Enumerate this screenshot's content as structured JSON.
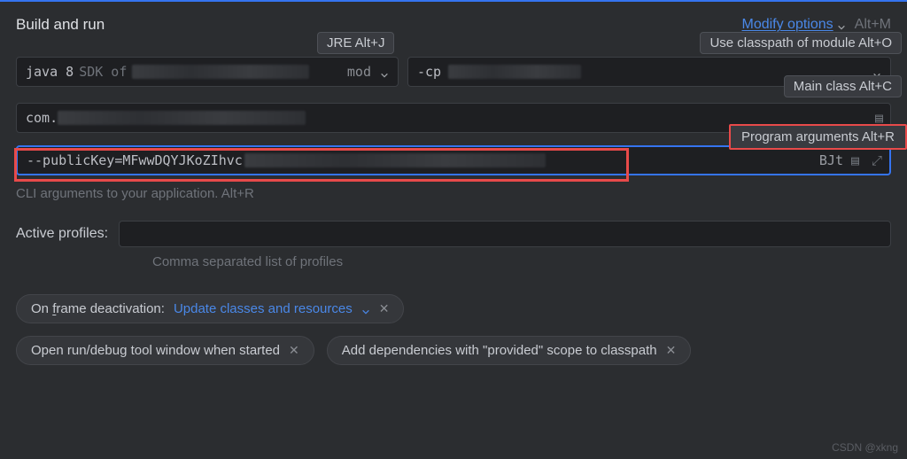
{
  "header": {
    "title": "Build and run",
    "modify_label": "Modify options",
    "modify_shortcut": "Alt+M"
  },
  "tooltips": {
    "jre": "JRE Alt+J",
    "classpath": "Use classpath of module Alt+O",
    "mainclass": "Main class Alt+C",
    "programargs": "Program arguments Alt+R"
  },
  "jre": {
    "value": "java 8",
    "suffix": "SDK of",
    "right_label": "mod"
  },
  "cp": {
    "value": "-cp"
  },
  "mainclass": {
    "value": "com."
  },
  "programargs": {
    "value": "--publicKey=MFwwDQYJKoZIhvc",
    "trailing": "BJt"
  },
  "helper": "CLI arguments to your application. Alt+R",
  "profiles": {
    "label": "Active profiles:",
    "hint": "Comma separated list of profiles"
  },
  "chips": {
    "frame_label": "On frame deactivation:",
    "frame_value": "Update classes and resources",
    "open_tool": "Open run/debug tool window when started",
    "add_deps": "Add dependencies with \"provided\" scope to classpath"
  },
  "watermark": "CSDN @xkng"
}
